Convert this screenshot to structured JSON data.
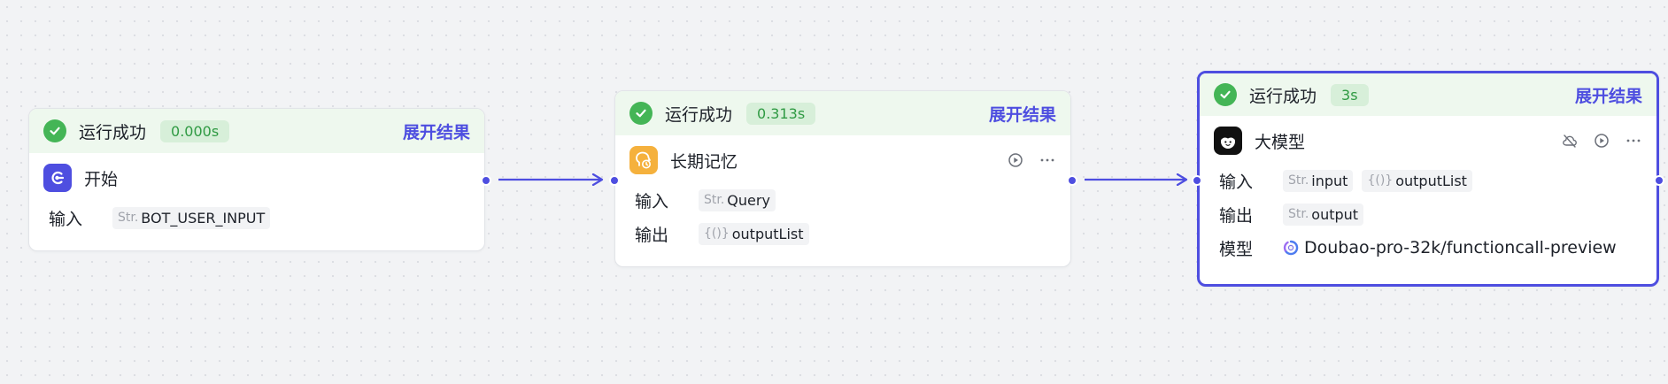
{
  "colors": {
    "accent": "#4e4ee0",
    "success": "#44b556",
    "success_bg": "#eef8ee"
  },
  "nodes": [
    {
      "status": "运行成功",
      "duration": "0.000s",
      "expand": "展开结果",
      "title": "开始",
      "icon": "start-icon",
      "rows": [
        {
          "label": "输入",
          "tags": [
            {
              "type": "Str.",
              "name": "BOT_USER_INPUT"
            }
          ]
        }
      ]
    },
    {
      "status": "运行成功",
      "duration": "0.313s",
      "expand": "展开结果",
      "title": "长期记忆",
      "icon": "long-term-memory-icon",
      "rows": [
        {
          "label": "输入",
          "tags": [
            {
              "type": "Str.",
              "name": "Query"
            }
          ]
        },
        {
          "label": "输出",
          "tags": [
            {
              "type": "{()}",
              "name": "outputList"
            }
          ]
        }
      ]
    },
    {
      "status": "运行成功",
      "duration": "3s",
      "expand": "展开结果",
      "title": "大模型",
      "icon": "llm-icon",
      "rows": [
        {
          "label": "输入",
          "tags": [
            {
              "type": "Str.",
              "name": "input"
            },
            {
              "type": "{()}",
              "name": "outputList"
            }
          ]
        },
        {
          "label": "输出",
          "tags": [
            {
              "type": "Str.",
              "name": "output"
            }
          ]
        },
        {
          "label": "模型",
          "model": "Doubao-pro-32k/functioncall-preview"
        }
      ]
    }
  ]
}
